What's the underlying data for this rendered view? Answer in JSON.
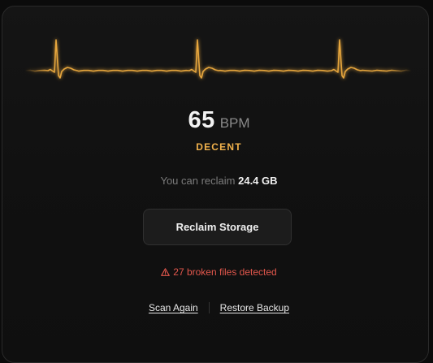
{
  "heart": {
    "bpm_value": "65",
    "bpm_unit": "BPM",
    "status": "DECENT",
    "status_color": "#f2b24c",
    "waveform_color": "#f5b040"
  },
  "reclaim": {
    "prefix": "You can reclaim",
    "amount": "24.4 GB",
    "button_label": "Reclaim Storage"
  },
  "warning": {
    "icon": "warning-triangle-icon",
    "text": "27 broken files detected",
    "color": "#e2574c"
  },
  "actions": {
    "scan_again": "Scan Again",
    "restore_backup": "Restore Backup"
  }
}
